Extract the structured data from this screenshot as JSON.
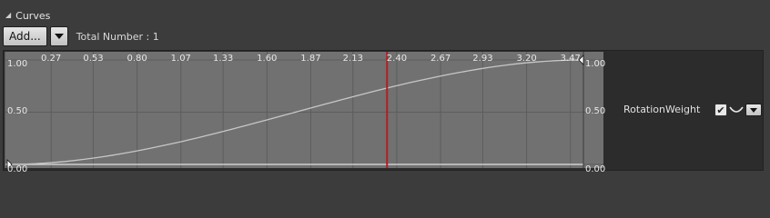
{
  "section": {
    "title": "Curves",
    "collapse_icon": "collapse-triangle-icon"
  },
  "toolbar": {
    "add_label": "Add...",
    "dropdown_icon": "chevron-down-icon",
    "total_label": "Total Number : 1"
  },
  "curve_editor": {
    "x_ticks": [
      "0.27",
      "0.53",
      "0.80",
      "1.07",
      "1.33",
      "1.60",
      "1.87",
      "2.13",
      "2.40",
      "2.67",
      "2.93",
      "3.20",
      "3.47"
    ],
    "x_range": [
      0,
      3.55
    ],
    "y_ticks_left": [
      "1.00",
      "0.50",
      "0.00"
    ],
    "y_ticks_right": [
      "1.00",
      "0.50",
      "0.00"
    ],
    "y_range": [
      0,
      1
    ],
    "playhead_time": 2.34,
    "playhead_color": "#b11f24",
    "grid_color": "#5d5d5d",
    "curve_color": "#c7c7c7",
    "background_color": "#717171",
    "keys": [
      {
        "time": 0.0,
        "value": 0.0
      },
      {
        "time": 3.55,
        "value": 1.0
      }
    ]
  },
  "track": {
    "name": "RotationWeight",
    "enabled": true,
    "check_icon": "check-icon",
    "curve_icon": "curve-shape-icon",
    "dropdown_icon": "chevron-down-icon"
  }
}
